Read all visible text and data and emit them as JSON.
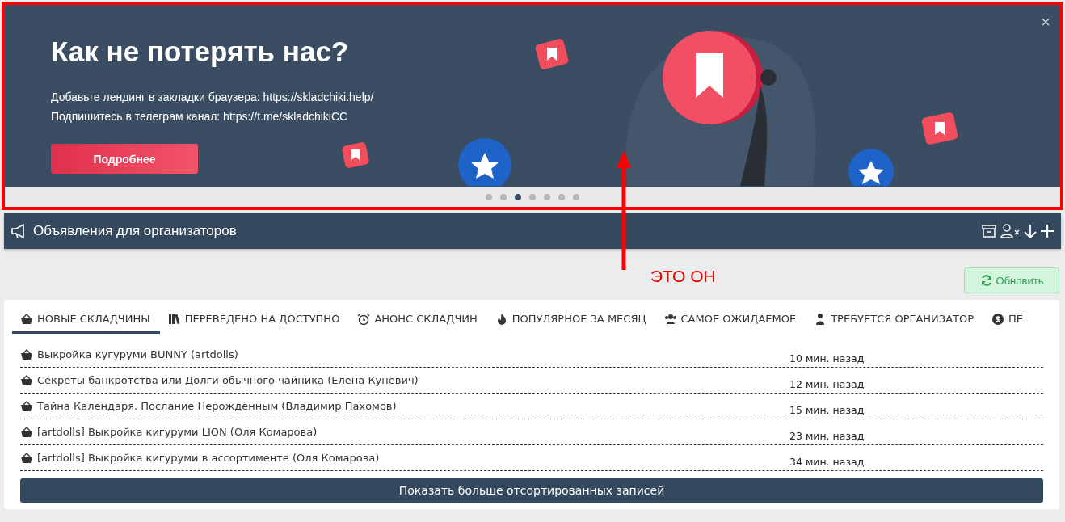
{
  "banner": {
    "title": "Как не потерять нас?",
    "lines": [
      "Добавьте лендинг в закладки браузера: https://skladchiki.help/",
      "Подпишитесь в телеграм канал: https://t.me/skladchikiCC"
    ],
    "button": "Подробнее",
    "close": "×",
    "dots": [
      {
        "selected": false
      },
      {
        "selected": false
      },
      {
        "selected": true
      },
      {
        "selected": false
      },
      {
        "selected": false
      },
      {
        "selected": false
      },
      {
        "selected": false
      }
    ]
  },
  "annotation": {
    "text": "ЭТО ОН"
  },
  "panel": {
    "title": "Объявления для организаторов"
  },
  "refresh_button": "Обновить",
  "tabs": [
    {
      "label": "НОВЫЕ СКЛАДЧИНЫ",
      "selected": true
    },
    {
      "label": "ПЕРЕВЕДЕНО НА ДОСТУПНО",
      "selected": false
    },
    {
      "label": "АНОНС СКЛАДЧИН",
      "selected": false
    },
    {
      "label": "ПОПУЛЯРНОЕ ЗА МЕСЯЦ",
      "selected": false
    },
    {
      "label": "САМОЕ ОЖИДАЕМОЕ",
      "selected": false
    },
    {
      "label": "ТРЕБУЕТСЯ ОРГАНИЗАТОР",
      "selected": false
    },
    {
      "label": "ПЕ",
      "selected": false
    }
  ],
  "rows": [
    {
      "title": "Выкройка кугуруми BUNNY (artdolls)",
      "time": "10 мин. назад"
    },
    {
      "title": "Секреты банкротства или Долги обычного чайника (Елена Куневич)",
      "time": "12 мин. назад"
    },
    {
      "title": "Тайна Календаря. Послание Нерождённым (Владимир Пахомов)",
      "time": "15 мин. назад"
    },
    {
      "title": "[artdolls] Выкройка кигуруми LION (Оля Комарова)",
      "time": "23 мин. назад"
    },
    {
      "title": "[artdolls] Выкройка кигуруми в ассортименте (Оля Комарова)",
      "time": "34 мин. назад"
    }
  ],
  "show_more": "Показать больше отсортированных записей"
}
